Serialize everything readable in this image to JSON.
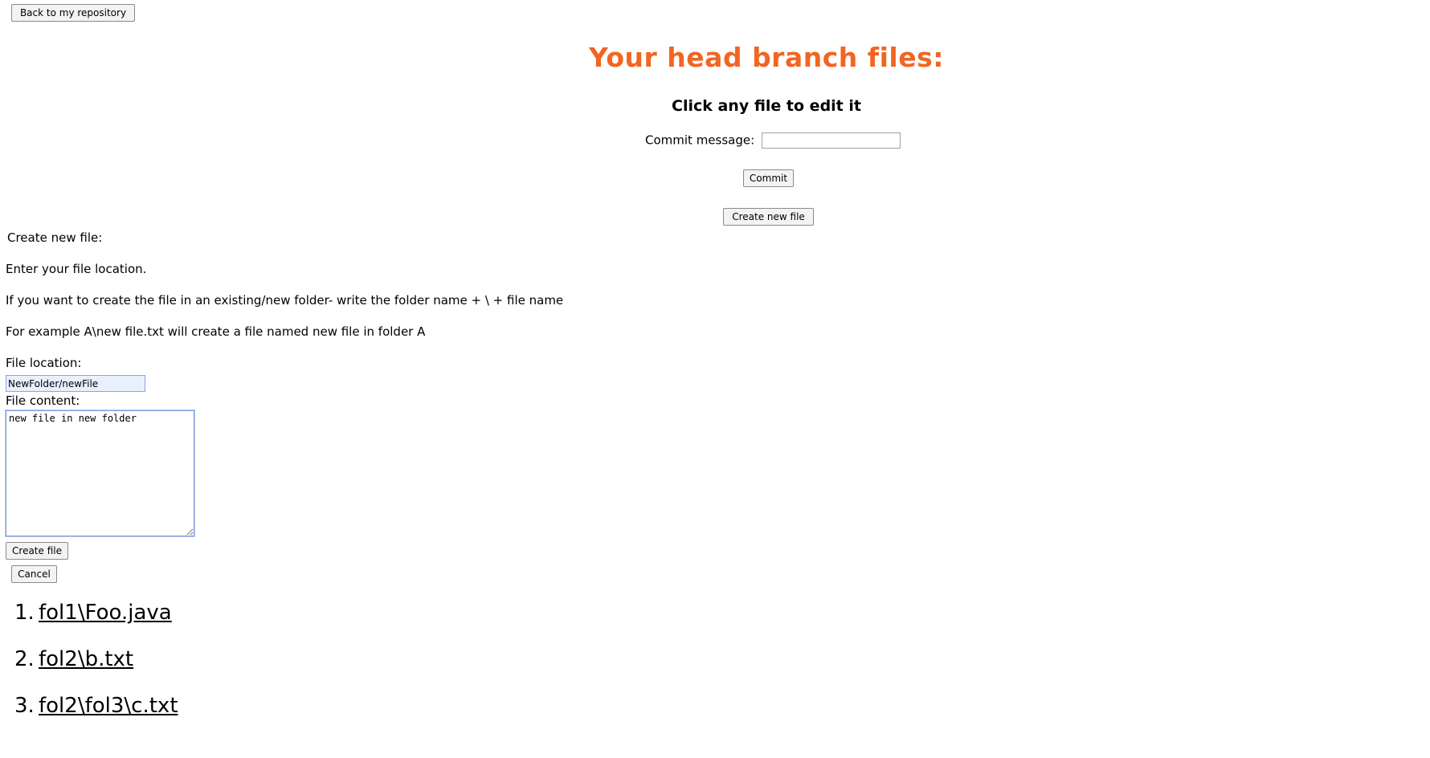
{
  "toolbar": {
    "back_label": "Back to my repository"
  },
  "header": {
    "title": "Your head branch files:",
    "subtitle": "Click any file to edit it"
  },
  "commit": {
    "label": "Commit message:",
    "value": "",
    "button_label": "Commit"
  },
  "create_new_file_button_label": "Create new file",
  "new_file_form": {
    "heading": "Create new file:",
    "instructions": [
      "Enter your file location.",
      "If you want to create the file in an existing/new folder- write the folder name + \\ + file name",
      "For example A\\new file.txt will create a file named new file in folder A"
    ],
    "location_label": "File location:",
    "location_value": "NewFolder/newFile",
    "content_label": "File content:",
    "content_value": "new file in new folder",
    "create_button_label": "Create file",
    "cancel_button_label": "Cancel"
  },
  "files": [
    {
      "number": "1.",
      "name": "fol1\\Foo.java"
    },
    {
      "number": "2.",
      "name": "fol2\\b.txt"
    },
    {
      "number": "3.",
      "name": "fol2\\fol3\\c.txt"
    }
  ]
}
